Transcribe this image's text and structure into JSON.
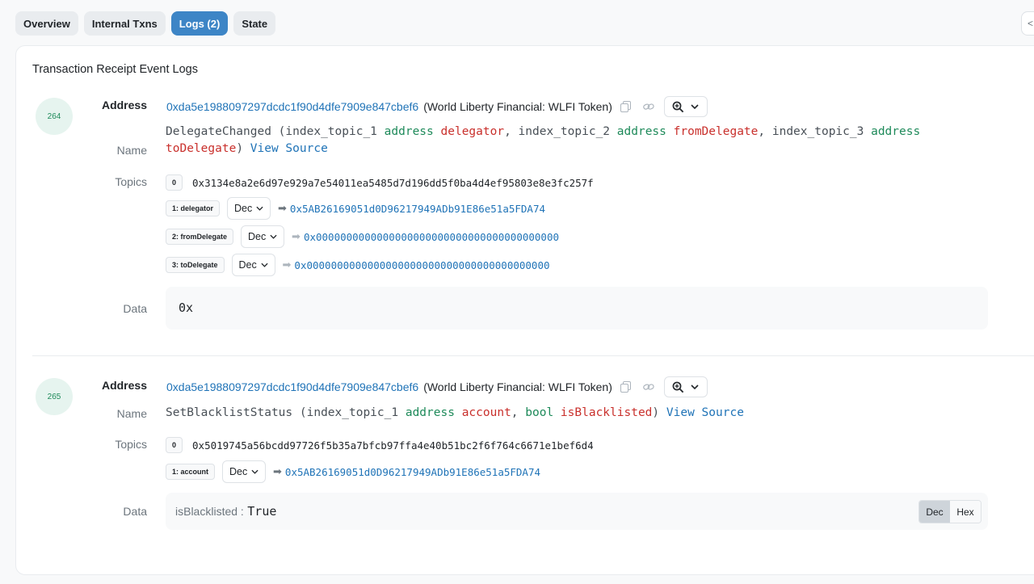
{
  "tabs": [
    {
      "label": "Overview"
    },
    {
      "label": "Internal Txns"
    },
    {
      "label": "Logs (2)"
    },
    {
      "label": "State"
    }
  ],
  "corner_button": {
    "label": "<"
  },
  "card": {
    "title": "Transaction Receipt Event Logs"
  },
  "labels": {
    "address": "Address",
    "name": "Name",
    "topics": "Topics",
    "data": "Data"
  },
  "logs": [
    {
      "index": "264",
      "address": "0xda5e1988097297dcdc1f90d4dfe7909e847cbef6",
      "address_name": "(World Liberty Financial: WLFI Token)",
      "signature": {
        "fn": "DelegateChanged",
        "open": " (",
        "p1_name": "index_topic_1",
        "p1_type": "address",
        "p1_arg": "delegator",
        "sep1": ", ",
        "p2_name": "index_topic_2",
        "p2_type": "address",
        "p2_arg": "fromDelegate",
        "sep2": ", ",
        "p3_name": "index_topic_3",
        "p3_type": "address",
        "p3_arg": "toDelegate",
        "close": ")",
        "view_source": "View Source"
      },
      "topics": [
        {
          "badge": "0",
          "value": "0x3134e8a2e6d97e929a7e54011ea5485d7d196dd5f0ba4d4ef95803e8e3fc257f"
        },
        {
          "badge": "1: delegator",
          "format": "Dec",
          "value": "0x5AB26169051d0D96217949ADb91E86e51a5FDA74"
        },
        {
          "badge": "2: fromDelegate",
          "format": "Dec",
          "value": "0x0000000000000000000000000000000000000000"
        },
        {
          "badge": "3: toDelegate",
          "format": "Dec",
          "value": "0x0000000000000000000000000000000000000000"
        }
      ],
      "data": "0x"
    },
    {
      "index": "265",
      "address": "0xda5e1988097297dcdc1f90d4dfe7909e847cbef6",
      "address_name": "(World Liberty Financial: WLFI Token)",
      "signature": {
        "fn": "SetBlacklistStatus",
        "open": " (",
        "p1_name": "index_topic_1",
        "p1_type": "address",
        "p1_arg": "account",
        "sep1": ", ",
        "p2_type": "bool",
        "p2_arg": "isBlacklisted",
        "close": ")",
        "view_source": "View Source"
      },
      "topics": [
        {
          "badge": "0",
          "value": "0x5019745a56bcdd97726f5b35a7bfcb97ffa4e40b51bc2f6f764c6671e1bef6d4"
        },
        {
          "badge": "1: account",
          "format": "Dec",
          "value": "0x5AB26169051d0D96217949ADb91E86e51a5FDA74"
        }
      ],
      "data": {
        "key": "isBlacklisted :",
        "value": "True"
      },
      "data_toggle": {
        "dec": "Dec",
        "hex": "Hex",
        "selected": "Dec"
      }
    }
  ],
  "icons": [
    "copy-icon",
    "link-icon",
    "zoom-icon",
    "chevron-down-icon",
    "arrow-right-icon"
  ],
  "colors": {
    "accent": "#3d85c6",
    "link": "#1f73b7",
    "type_green": "#1e8a5a",
    "arg_red": "#c9302c"
  }
}
